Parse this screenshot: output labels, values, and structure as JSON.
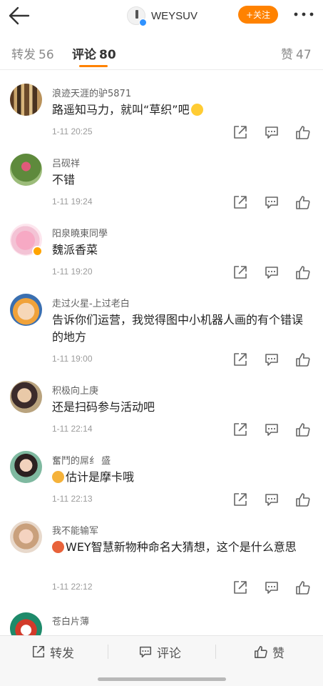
{
  "header": {
    "account_name": "WEYSUV",
    "follow_label": "+关注"
  },
  "tabs": [
    {
      "label": "转发",
      "count": "56"
    },
    {
      "label": "评论",
      "count": "80"
    },
    {
      "label": "赞",
      "count": "47"
    }
  ],
  "comments": [
    {
      "user": "浪迹天涯的驴5871",
      "text": "路遥知马力，就叫“草织”吧",
      "time": "1-11 20:25"
    },
    {
      "user": "吕砚祥",
      "text": "不错",
      "time": "1-11 19:24"
    },
    {
      "user": "阳泉曉東同學",
      "text": "魏派香菜",
      "time": "1-11 19:20"
    },
    {
      "user": "走过火星-上过老白",
      "text": "告诉你们运营，我觉得图中小机器人画的有个错误的地方",
      "time": "1-11 19:00"
    },
    {
      "user": "积极向上庚",
      "text": "还是扫码参与活动吧",
      "time": "1-11 22:14"
    },
    {
      "user": "奮鬥的屌纟 盛",
      "text": "估计是摩卡哦",
      "time": "1-11 22:13"
    },
    {
      "user": "我不能输军",
      "text": "WEY智慧新物种命名大猜想，这个是什么意思",
      "time": "1-11 22:12"
    },
    {
      "user": "苍白片薄"
    }
  ],
  "bottom_bar": {
    "repost_label": "转发",
    "comment_label": "评论",
    "like_label": "赞"
  },
  "colors": {
    "accent": "#ff8200",
    "verified_blue": "#2f92ff",
    "verified_gold": "#ffa400"
  },
  "icons": [
    "back-arrow-icon",
    "more-dots-icon",
    "share-icon",
    "comment-icon",
    "like-icon",
    "emoji-icon"
  ]
}
